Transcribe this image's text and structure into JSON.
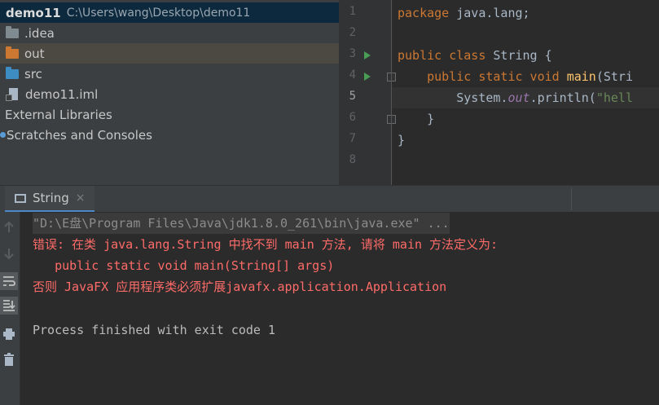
{
  "project": {
    "root_name": "demo11",
    "root_path": "C:\\Users\\wang\\Desktop\\demo11",
    "items": [
      {
        "label": ".idea",
        "icon": "folder-icon",
        "color": "#7f8b91"
      },
      {
        "label": "out",
        "icon": "folder-icon",
        "color": "#cc7832",
        "selected": true
      },
      {
        "label": "src",
        "icon": "folder-icon",
        "color": "#3d8cc2"
      },
      {
        "label": "demo11.iml",
        "icon": "iml-file-icon"
      },
      {
        "label": "External Libraries",
        "icon": "library-icon"
      },
      {
        "label": "Scratches and Consoles",
        "icon": "scratches-icon"
      }
    ]
  },
  "editor": {
    "line_numbers": [
      "1",
      "2",
      "3",
      "4",
      "5",
      "6",
      "7",
      "8"
    ],
    "current_line": "5",
    "lines": {
      "l1_kw": "package",
      "l1_rest": " java.lang;",
      "l3_kw1": "public",
      "l3_kw2": "class",
      "l3_rest": " String {",
      "l4_kw": "public static void",
      "l4_fn": "main",
      "l4_rest": "(Stri",
      "l5_a": "System.",
      "l5_field": "out",
      "l5_b": ".println(",
      "l5_str": "\"hell",
      "l6": "}",
      "l7": "}"
    }
  },
  "run": {
    "tab_label": "String",
    "tab_close": "×",
    "console": {
      "command": "\"D:\\E盘\\Program Files\\Java\\jdk1.8.0_261\\bin\\java.exe\" ...",
      "error1": "错误: 在类 java.lang.String 中找不到 main 方法, 请将 main 方法定义为:",
      "error2": "   public static void main(String[] args)",
      "error3": "否则 JavaFX 应用程序类必须扩展javafx.application.Application",
      "finish": "Process finished with exit code 1"
    },
    "toolbar": [
      "up-arrow-icon",
      "down-arrow-icon",
      "soft-wrap-icon",
      "scroll-to-end-icon",
      "print-icon",
      "trash-icon"
    ]
  }
}
